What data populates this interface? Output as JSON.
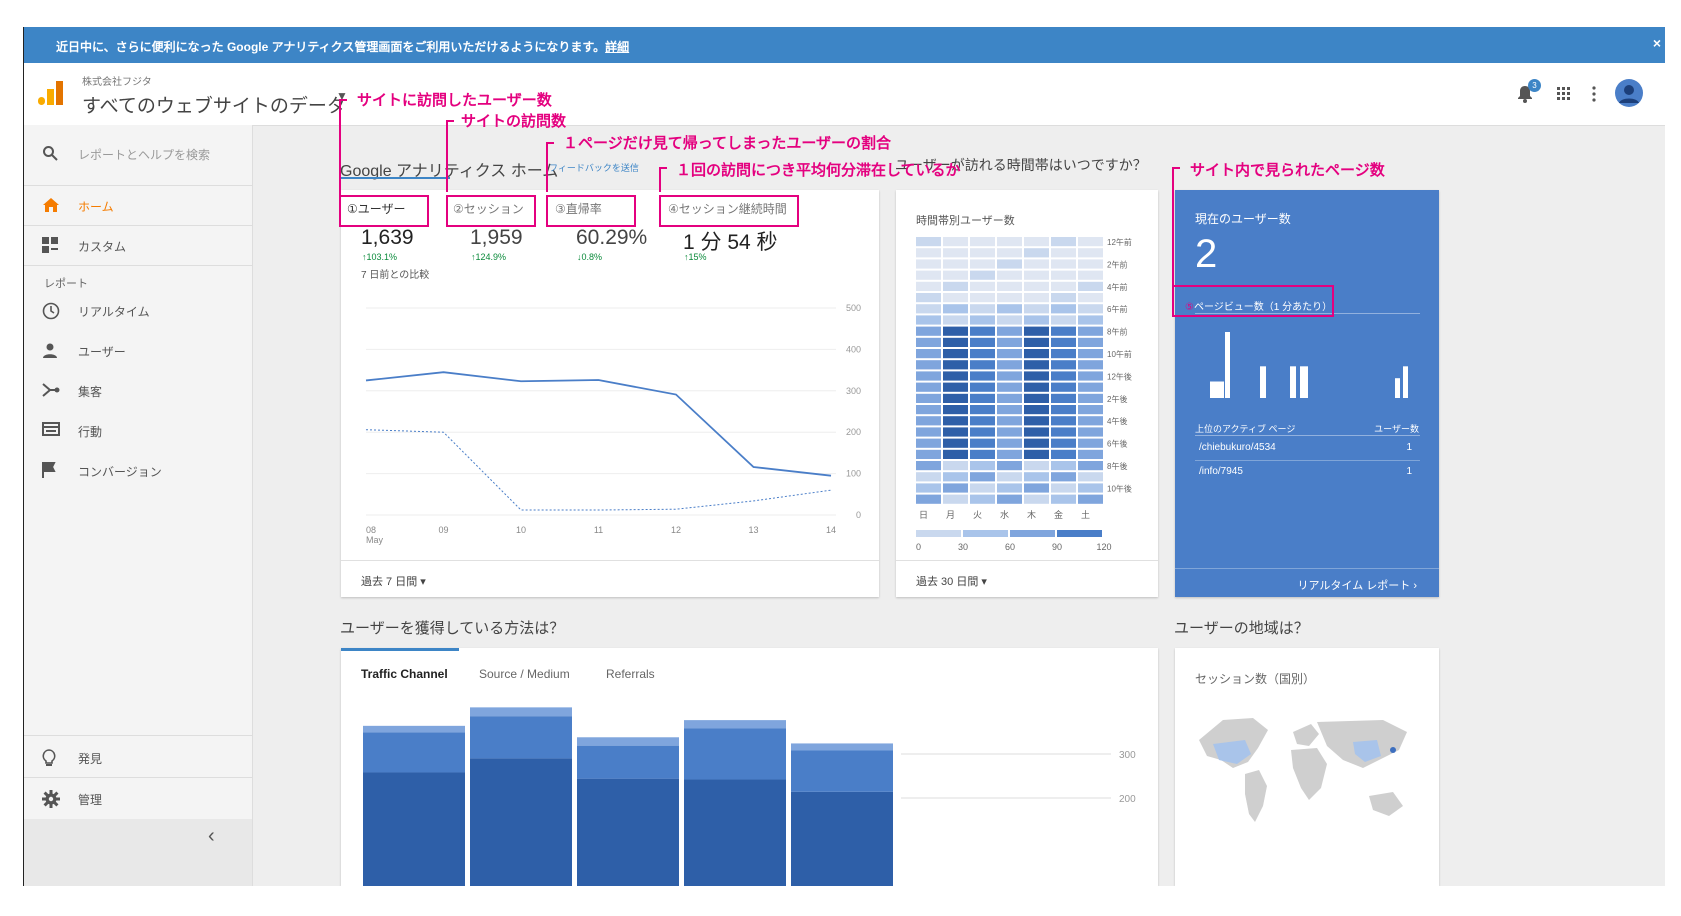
{
  "banner": {
    "text": "近日中に、さらに便利になった Google アナリティクス管理画面をご利用いただけるようになります。",
    "link": "詳細",
    "close": "×"
  },
  "header": {
    "account": "株式会社フジタ",
    "property": "すべてのウェブサイトのデータ",
    "notification_count": "3"
  },
  "sidebar": {
    "search_placeholder": "レポートとヘルプを検索",
    "home": "ホーム",
    "custom": "カスタム",
    "reports_heading": "レポート",
    "realtime": "リアルタイム",
    "users": "ユーザー",
    "acquisition": "集客",
    "behavior": "行動",
    "conversion": "コンバージョン",
    "discover": "発見",
    "admin": "管理",
    "collapse": "‹"
  },
  "home": {
    "title": "Google アナリティクス ホーム",
    "feedback": "フィードバックを送信",
    "metrics": [
      {
        "label": "①ユーザー",
        "value": "1,639",
        "change": "↑103.1%"
      },
      {
        "label": "②セッション",
        "value": "1,959",
        "change": "↑124.9%"
      },
      {
        "label": "③直帰率",
        "value": "60.29%",
        "change": "↓0.8%"
      },
      {
        "label": "④セッション継続時間",
        "value": "1 分 54 秒",
        "change": "↑15%"
      }
    ],
    "compare_text": "7 日前との比較",
    "date_range": "過去 7 日間"
  },
  "chart_data": [
    {
      "type": "line",
      "x": [
        "08 May",
        "09",
        "10",
        "11",
        "12",
        "13",
        "14"
      ],
      "series": [
        {
          "values": [
            325,
            345,
            323,
            326,
            291,
            116,
            95
          ]
        },
        {
          "values": [
            206,
            200,
            12,
            12,
            14,
            34,
            60
          ]
        }
      ],
      "yticks": [
        "500",
        "400",
        "300",
        "200",
        "100",
        "0"
      ],
      "ylim": [
        0,
        500
      ]
    },
    {
      "type": "heatmap",
      "title": "時間帯別ユーザー数",
      "x": [
        "日",
        "月",
        "火",
        "水",
        "木",
        "金",
        "土"
      ],
      "y_labels": [
        "12午前",
        "2午前",
        "4午前",
        "6午前",
        "8午前",
        "10午前",
        "12午後",
        "2午後",
        "4午後",
        "6午後",
        "8午後",
        "10午後"
      ],
      "legend_ticks": [
        "0",
        "30",
        "60",
        "90",
        "120"
      ]
    },
    {
      "type": "bar",
      "title": "Traffic Channel",
      "stacked": true,
      "series": [
        {
          "values": [
            258,
            290,
            244,
            242,
            214
          ]
        },
        {
          "values": [
            91,
            96,
            75,
            116,
            94
          ]
        },
        {
          "values": [
            15,
            20,
            19,
            19,
            16
          ]
        }
      ],
      "yticks": [
        "300",
        "200"
      ]
    }
  ],
  "time_card": {
    "question": "ユーザーが訪れる時間帯はいつですか？",
    "date_range": "過去 30 日間"
  },
  "realtime": {
    "title": "現在のユーザー数",
    "value": "2",
    "pageview_label": "ページビュー数（1 分あたり）",
    "col_page": "上位のアクティブ ページ",
    "col_users": "ユーザー数",
    "rows": [
      {
        "page": "/chiebukuro/4534",
        "users": "1"
      },
      {
        "page": "/info/7945",
        "users": "1"
      }
    ],
    "link": "リアルタイム レポート",
    "bars": [
      0.25,
      1.0,
      0.48,
      0.48,
      0.48,
      0.3,
      0.48
    ]
  },
  "acquisition": {
    "question": "ユーザーを獲得している方法は？",
    "tabs": [
      "Traffic Channel",
      "Source / Medium",
      "Referrals"
    ]
  },
  "geo": {
    "question": "ユーザーの地域は？",
    "title": "セッション数（国別）"
  },
  "annotations": {
    "users": "サイトに訪問したユーザー数",
    "sessions": "サイトの訪問数",
    "bounce": "１ページだけ見て帰ってしまったユーザーの割合",
    "duration": "１回の訪問につき平均何分滞在しているか",
    "pageviews": "サイト内で見られたページ数",
    "pv_marker": "⑤"
  },
  "colors": {
    "banner": "#3d85c6",
    "accent": "#f57c00",
    "realtime": "#4a7ec8",
    "annotation": "#e4007f"
  }
}
